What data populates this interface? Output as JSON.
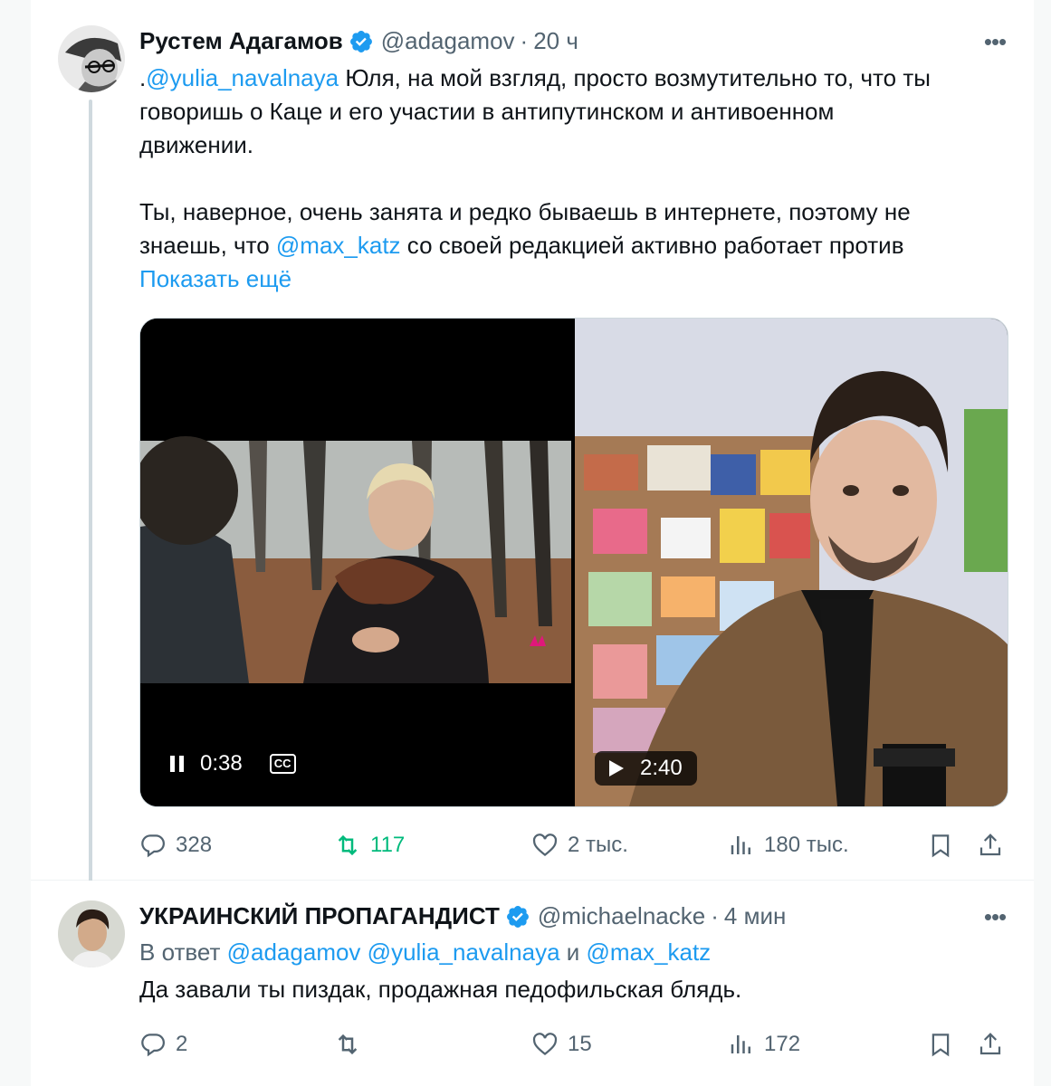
{
  "tweet1": {
    "author": "Рустем Адагамов",
    "handle": "@adagamov",
    "time": "20 ч",
    "text": {
      "mention1": "@yulia_navalnaya",
      "line1_prefix": ".",
      "line1_rest": " Юля, на мой взгляд, просто возмутительно то, что ты",
      "line2": "говоришь о Каце и его участии в антипутинском и антивоенном",
      "line3": "движении.",
      "line4": "Ты, наверное, очень занята и редко бываешь в интернете, поэтому не",
      "line5_prefix": "знаешь, что ",
      "mention2": "@max_katz",
      "line5_rest": "  со своей редакцией активно работает против",
      "show_more": "Показать ещё"
    },
    "video_left": {
      "time": "0:38",
      "cc": "CC",
      "channel_mark": "///"
    },
    "video_right": {
      "time": "2:40"
    },
    "stats": {
      "replies": "328",
      "retweets": "117",
      "likes": "2 тыс.",
      "views": "180 тыс."
    }
  },
  "tweet2": {
    "author": "УКРАИНСКИЙ ПРОПАГАНДИСТ",
    "handle": "@michaelnacke",
    "time": "4 мин",
    "reply_prefix": "В ответ ",
    "reply_to1": "@adagamov",
    "reply_to2": "@yulia_navalnaya",
    "reply_and": " и ",
    "reply_to3": "@max_katz",
    "text": "Да завали ты пиздак, продажная педофильская блядь.",
    "stats": {
      "replies": "2",
      "retweets": "",
      "likes": "15",
      "views": "172"
    }
  },
  "colors": {
    "accent": "#1d9bf0",
    "retweet": "#00ba7c",
    "muted": "#536471"
  }
}
